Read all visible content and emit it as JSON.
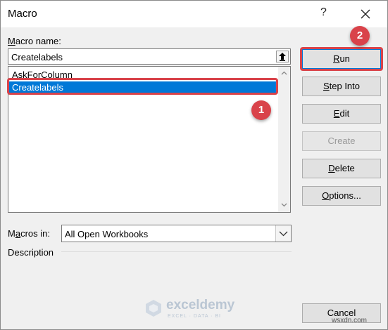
{
  "window": {
    "title": "Macro",
    "help_label": "?"
  },
  "macro_name": {
    "label": "Macro name:",
    "value": "Createlabels"
  },
  "macros_list": {
    "items": [
      "AskForColumn",
      "Createlabels"
    ],
    "selected_index": 1
  },
  "buttons": {
    "run": "Run",
    "step_into": "Step Into",
    "edit": "Edit",
    "create": "Create",
    "delete": "Delete",
    "options": "Options...",
    "cancel": "Cancel"
  },
  "macros_in": {
    "label": "Macros in:",
    "value": "All Open Workbooks"
  },
  "description": {
    "label": "Description"
  },
  "annotations": {
    "badge_1": "1",
    "badge_2": "2"
  },
  "watermark": {
    "name": "exceldemy",
    "tagline": "EXCEL · DATA · BI"
  },
  "site_mark": "wsxdn.com",
  "colors": {
    "selection": "#0078d7",
    "annotation": "#d9434a",
    "button_face": "#e1e1e1"
  }
}
